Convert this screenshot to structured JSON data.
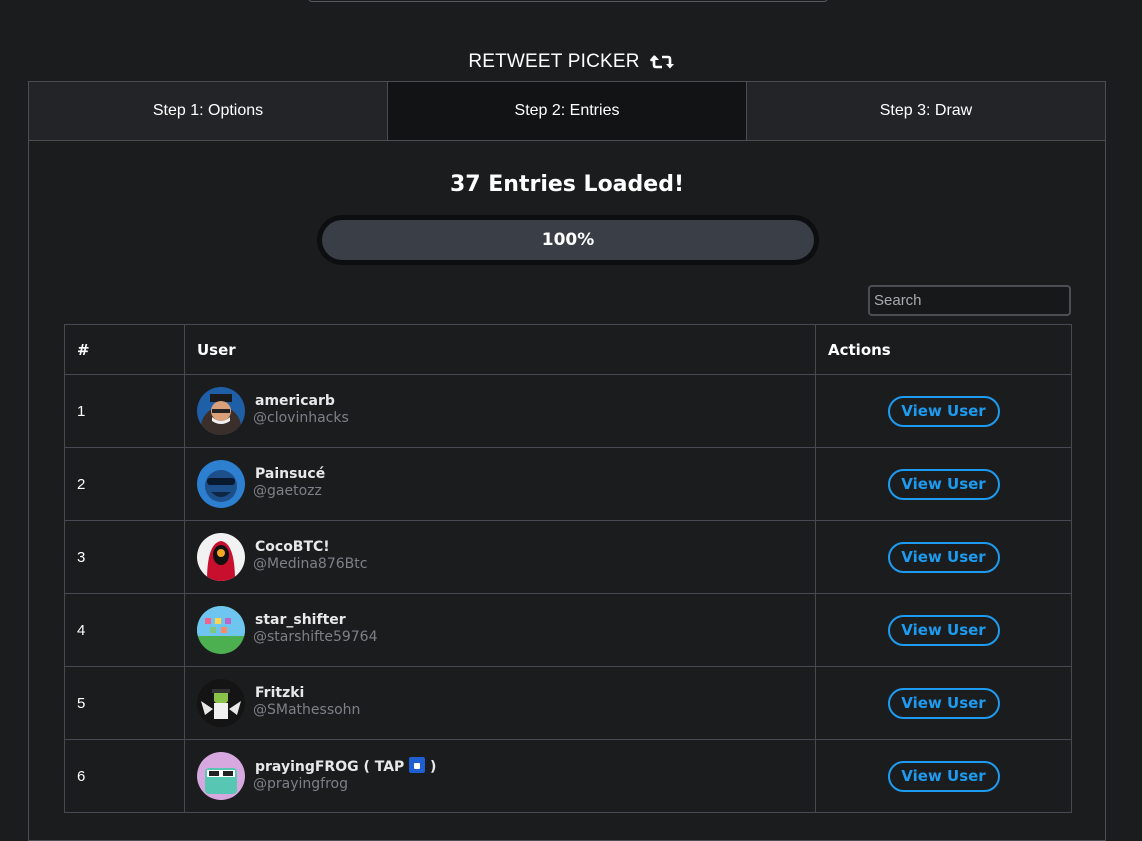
{
  "header": {
    "title": "RETWEET PICKER",
    "title_icon": "retweet-icon"
  },
  "tabs": [
    {
      "label": "Step 1: Options",
      "active": false
    },
    {
      "label": "Step 2: Entries",
      "active": true
    },
    {
      "label": "Step 3: Draw",
      "active": false
    }
  ],
  "status": {
    "title": "37 Entries Loaded!",
    "progress_label": "100%",
    "progress_value": 1.0
  },
  "search": {
    "placeholder": "Search",
    "value": ""
  },
  "table": {
    "columns": [
      "#",
      "User",
      "Actions"
    ],
    "rows": [
      {
        "num": "1",
        "name": "americarb",
        "handle": "@clovinhacks",
        "action": "View User"
      },
      {
        "num": "2",
        "name": "Painsucé",
        "handle": "@gaetozz",
        "action": "View User"
      },
      {
        "num": "3",
        "name": "CocoBTC!",
        "handle": "@Medina876Btc",
        "action": "View User"
      },
      {
        "num": "4",
        "name": "star_shifter",
        "handle": "@starshifte59764",
        "action": "View User"
      },
      {
        "num": "5",
        "name": "Fritzki",
        "handle": "@SMathessohn",
        "action": "View User"
      },
      {
        "num": "6",
        "name": "prayingFROG ( TAP",
        "name_suffix": " )",
        "handle": "@prayingfrog",
        "action": "View User"
      }
    ]
  },
  "colors": {
    "background": "#1b1c1e",
    "accent": "#1d9bf0",
    "border": "#454a52",
    "muted_text": "#7c8087"
  }
}
